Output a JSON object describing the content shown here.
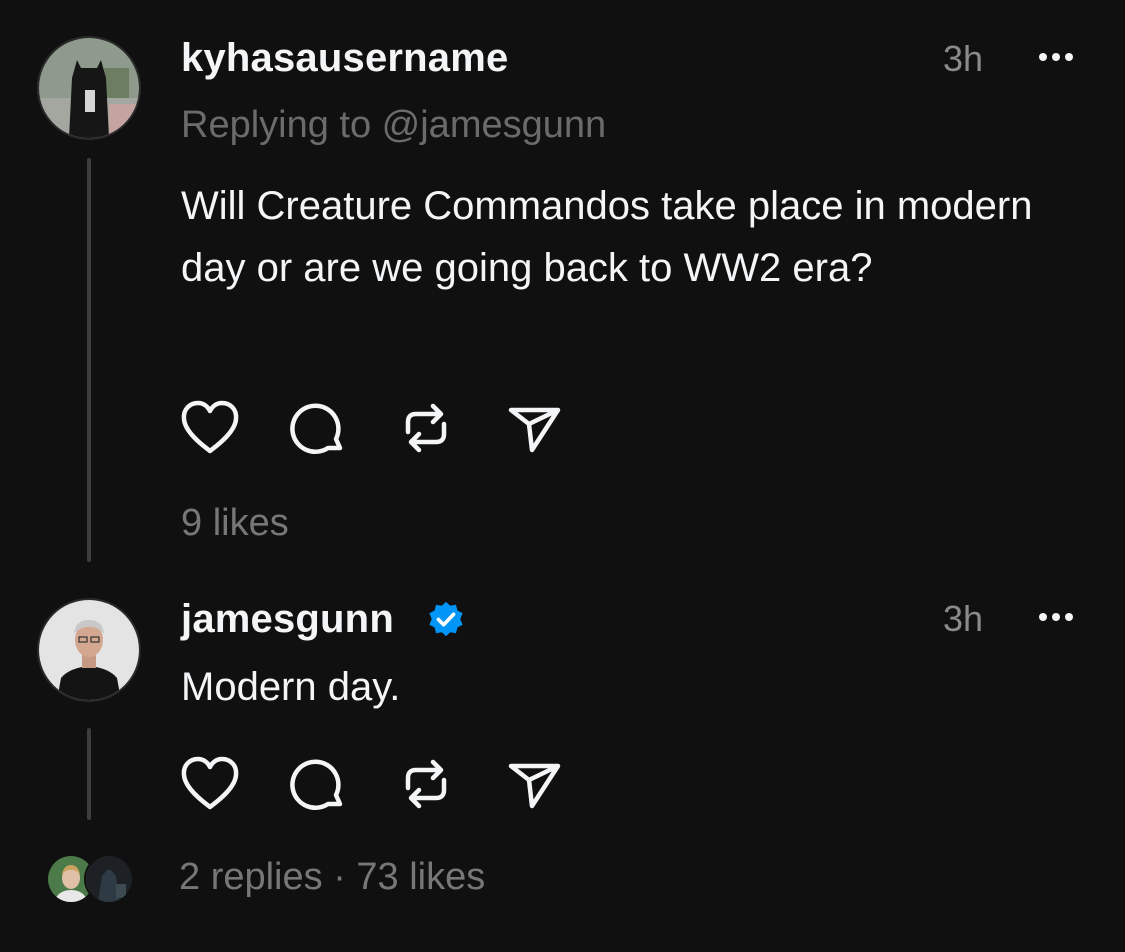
{
  "posts": [
    {
      "username": "kyhasausername",
      "time": "3h",
      "replying_to": "Replying to @jamesgunn",
      "text": "Will Creature Commandos take place in modern day or are we going back to WW2 era?",
      "likes": "9 likes",
      "verified": false
    },
    {
      "username": "jamesgunn",
      "time": "3h",
      "text": "Modern day.",
      "footer": "2 replies · 73 likes",
      "verified": true
    }
  ],
  "colors": {
    "background": "#101010",
    "text": "#f3f5f7",
    "muted": "#6b6b6b",
    "verified": "#0095f6"
  },
  "icons": [
    "heart-icon",
    "comment-icon",
    "repost-icon",
    "share-icon",
    "more-icon",
    "verified-badge-icon"
  ]
}
